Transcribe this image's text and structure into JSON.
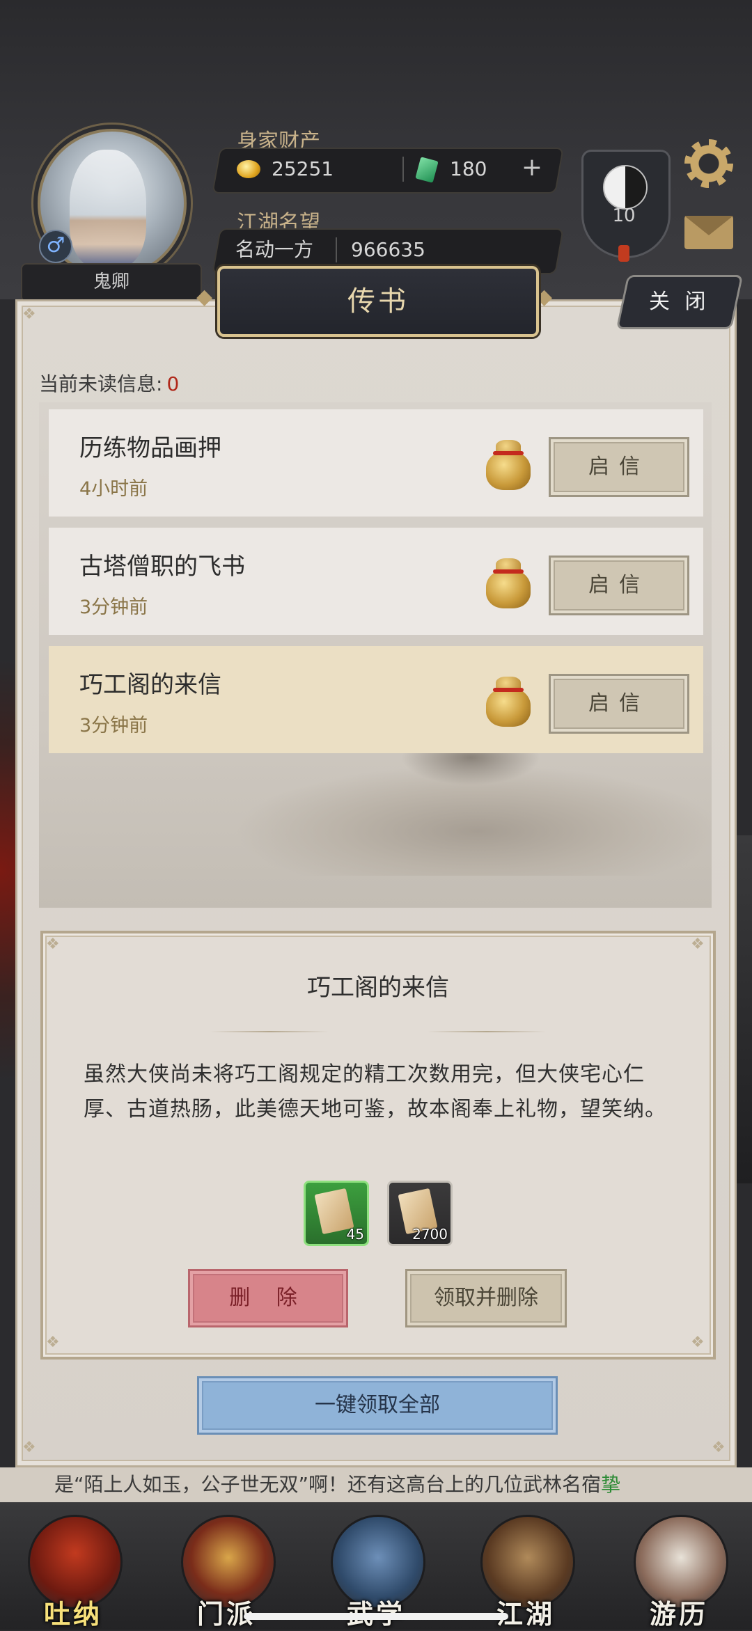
{
  "profile": {
    "name": "鬼卿",
    "gender_symbol": "♂",
    "wealth_label": "身家财产",
    "gold": "25251",
    "jade": "180",
    "reputation_label": "江湖名望",
    "reputation_title": "名动一方",
    "reputation_value": "966635",
    "level": "10"
  },
  "panel": {
    "title": "传书",
    "close_label": "关 闭",
    "unread_label": "当前未读信息:",
    "unread_count": "0"
  },
  "mails": [
    {
      "title": "历练物品画押",
      "time": "4小时前",
      "open_label": "启信",
      "icon": "money-bag-icon"
    },
    {
      "title": "古塔僧职的飞书",
      "time": "3分钟前",
      "open_label": "启信",
      "icon": "money-bag-icon"
    },
    {
      "title": "巧工阁的来信",
      "time": "3分钟前",
      "open_label": "启信",
      "icon": "money-bag-icon",
      "selected": true
    }
  ],
  "detail": {
    "title": "巧工阁的来信",
    "body": "虽然大侠尚未将巧工阁规定的精工次数用完，但大侠宅心仁厚、古道热肠，此美德天地可鉴，故本阁奉上礼物，望笑纳。",
    "rewards": [
      {
        "quantity": "45",
        "frame": "#3c9f3e"
      },
      {
        "quantity": "2700",
        "frame": "#3b3a3b"
      }
    ],
    "delete_label": "删 除",
    "claim_delete_label": "领取并删除"
  },
  "claim_all_label": "一键领取全部",
  "ticker": {
    "text": "是“陌上人如玉，公子世无双”啊！还有这高台上的几位武林名宿",
    "highlight": "挚"
  },
  "nav": [
    {
      "label": "吐纳",
      "active": true
    },
    {
      "label": "门派"
    },
    {
      "label": "武学"
    },
    {
      "label": "江湖"
    },
    {
      "label": "游历"
    }
  ]
}
